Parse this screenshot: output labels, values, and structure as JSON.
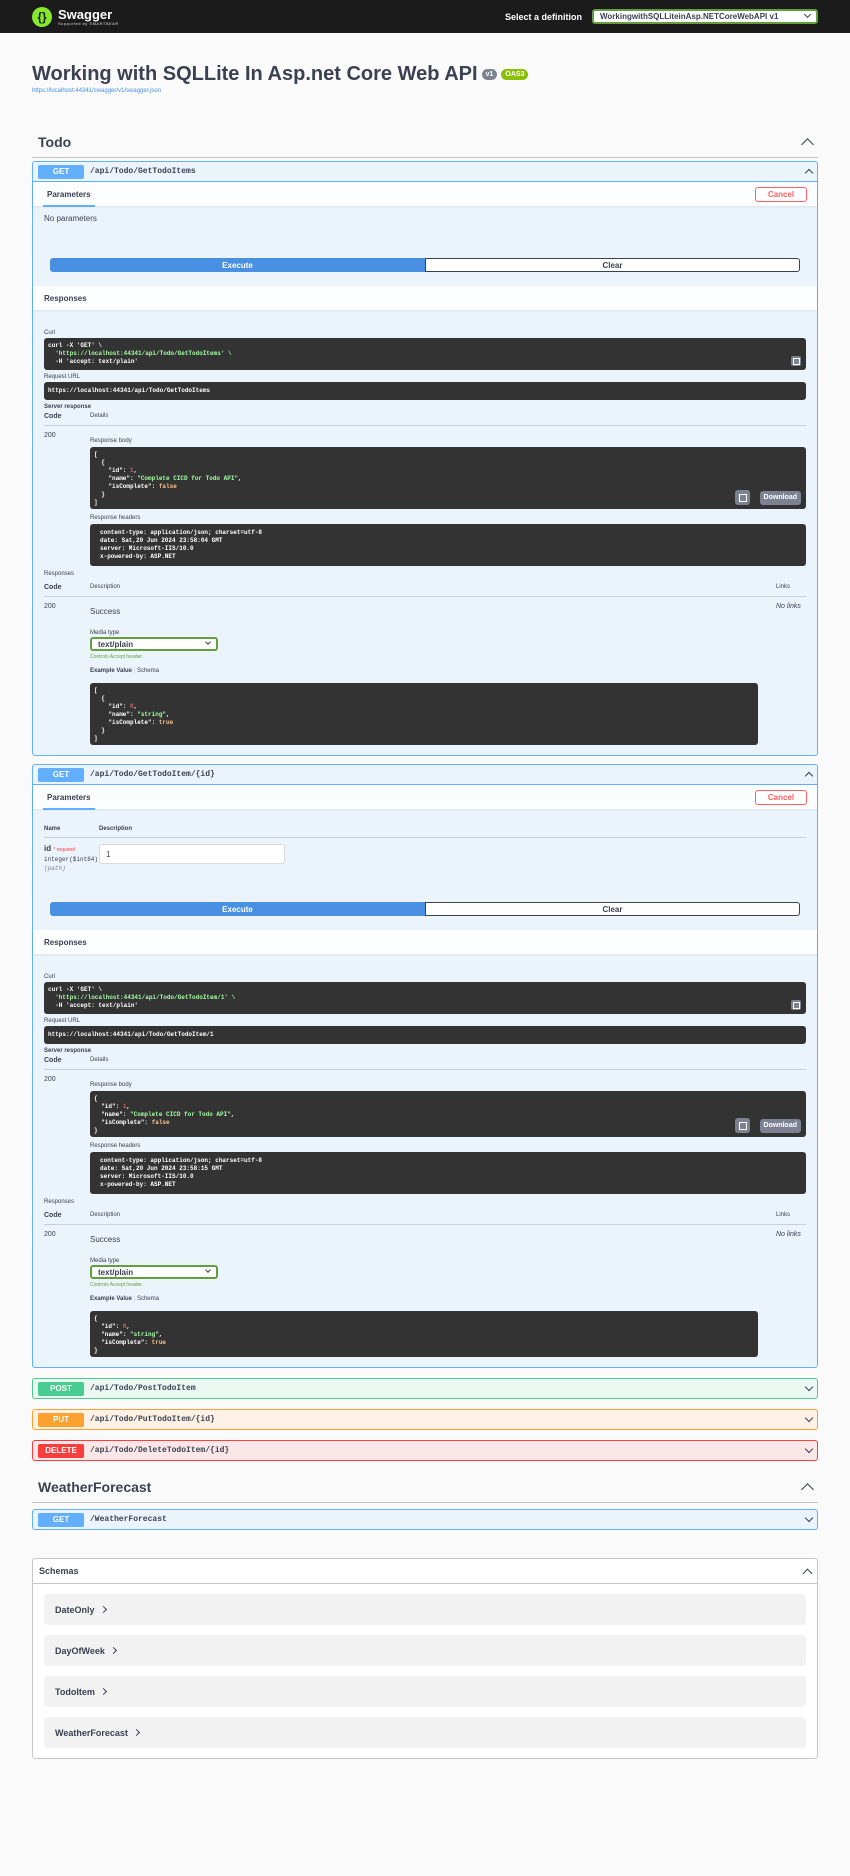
{
  "topbar": {
    "logo_text": "Swagger",
    "logo_sub": "Supported by SMARTBEAR",
    "select_label": "Select a definition",
    "selected_definition": "WorkingwithSQLLiteinAsp.NETCoreWebAPI v1"
  },
  "info": {
    "title": "Working with SQLLite In Asp.net Core Web API",
    "version_badge": "v1",
    "oas_badge": "OAS3",
    "url": "https://localhost:44341/swagger/v1/swagger.json"
  },
  "todo": {
    "name": "Todo",
    "op1": {
      "method": "GET",
      "path": "/api/Todo/GetTodoItems",
      "params_tab": "Parameters",
      "cancel": "Cancel",
      "no_params": "No parameters",
      "execute": "Execute",
      "clear": "Clear",
      "responses_title": "Responses",
      "curl_label": "Curl",
      "curl_line1": "curl -X 'GET' \\",
      "curl_line2": "  'https://localhost:44341/api/Todo/GetTodoItems' \\",
      "curl_line3": "  -H 'accept: text/plain'",
      "request_url_label": "Request URL",
      "request_url": "https://localhost:44341/api/Todo/GetTodoItems",
      "server_response_label": "Server response",
      "code_col": "Code",
      "details_col": "Details",
      "code": "200",
      "response_body_label": "Response body",
      "download": "Download",
      "response_headers_label": "Response headers",
      "headers": "content-type: application/json; charset=utf-8\ndate: Sat,20 Jun 2024 23:58:04 GMT\nserver: Microsoft-IIS/10.0\nx-powered-by: ASP.NET",
      "responses_label": "Responses",
      "description_col": "Description",
      "links_col": "Links",
      "success": "Success",
      "no_links": "No links",
      "media_type_label": "Media type",
      "media_type": "text/plain",
      "controls": "Controls Accept header.",
      "example_value": "Example Value",
      "schema": "Schema"
    },
    "op2": {
      "method": "GET",
      "path": "/api/Todo/GetTodoItem/{id}",
      "params_tab": "Parameters",
      "cancel": "Cancel",
      "name_col": "Name",
      "description_col": "Description",
      "param_name": "id",
      "required": "* required",
      "param_type": "integer($int64)",
      "param_in": "(path)",
      "param_value": "1",
      "execute": "Execute",
      "clear": "Clear",
      "responses_title": "Responses",
      "curl_label": "Curl",
      "curl_line1": "curl -X 'GET' \\",
      "curl_line2": "  'https://localhost:44341/api/Todo/GetTodoItem/1' \\",
      "curl_line3": "  -H 'accept: text/plain'",
      "request_url_label": "Request URL",
      "request_url": "https://localhost:44341/api/Todo/GetTodoItem/1",
      "server_response_label": "Server response",
      "code_col": "Code",
      "details_col": "Details",
      "code": "200",
      "response_body_label": "Response body",
      "download": "Download",
      "response_headers_label": "Response headers",
      "headers": "content-type: application/json; charset=utf-8\ndate: Sat,20 Jun 2024 23:58:15 GMT\nserver: Microsoft-IIS/10.0\nx-powered-by: ASP.NET",
      "responses_label": "Responses",
      "links_col": "Links",
      "success": "Success",
      "no_links": "No links",
      "media_type_label": "Media type",
      "media_type": "text/plain",
      "controls": "Controls Accept header.",
      "example_value": "Example Value",
      "schema": "Schema"
    },
    "op3": {
      "method": "POST",
      "path": "/api/Todo/PostTodoItem"
    },
    "op4": {
      "method": "PUT",
      "path": "/api/Todo/PutTodoItem/{id}"
    },
    "op5": {
      "method": "DELETE",
      "path": "/api/Todo/DeleteTodoItem/{id}"
    }
  },
  "weather": {
    "name": "WeatherForecast",
    "op1": {
      "method": "GET",
      "path": "/WeatherForecast"
    }
  },
  "schemas": {
    "title": "Schemas",
    "items": [
      "DateOnly",
      "DayOfWeek",
      "TodoItem",
      "WeatherForecast"
    ]
  },
  "json_body": {
    "open_bracket": "[",
    "open_brace": "{",
    "id_key": "\"id\"",
    "id_val": "1",
    "name_key": "\"name\"",
    "name_val": "\"Complete CICD for Todo API\"",
    "complete_key": "\"isComplete\"",
    "complete_val": "false",
    "close_brace": "}",
    "close_bracket": "]"
  },
  "json_example": {
    "id_val": "0",
    "name_val": "\"string\"",
    "complete_val": "true"
  }
}
